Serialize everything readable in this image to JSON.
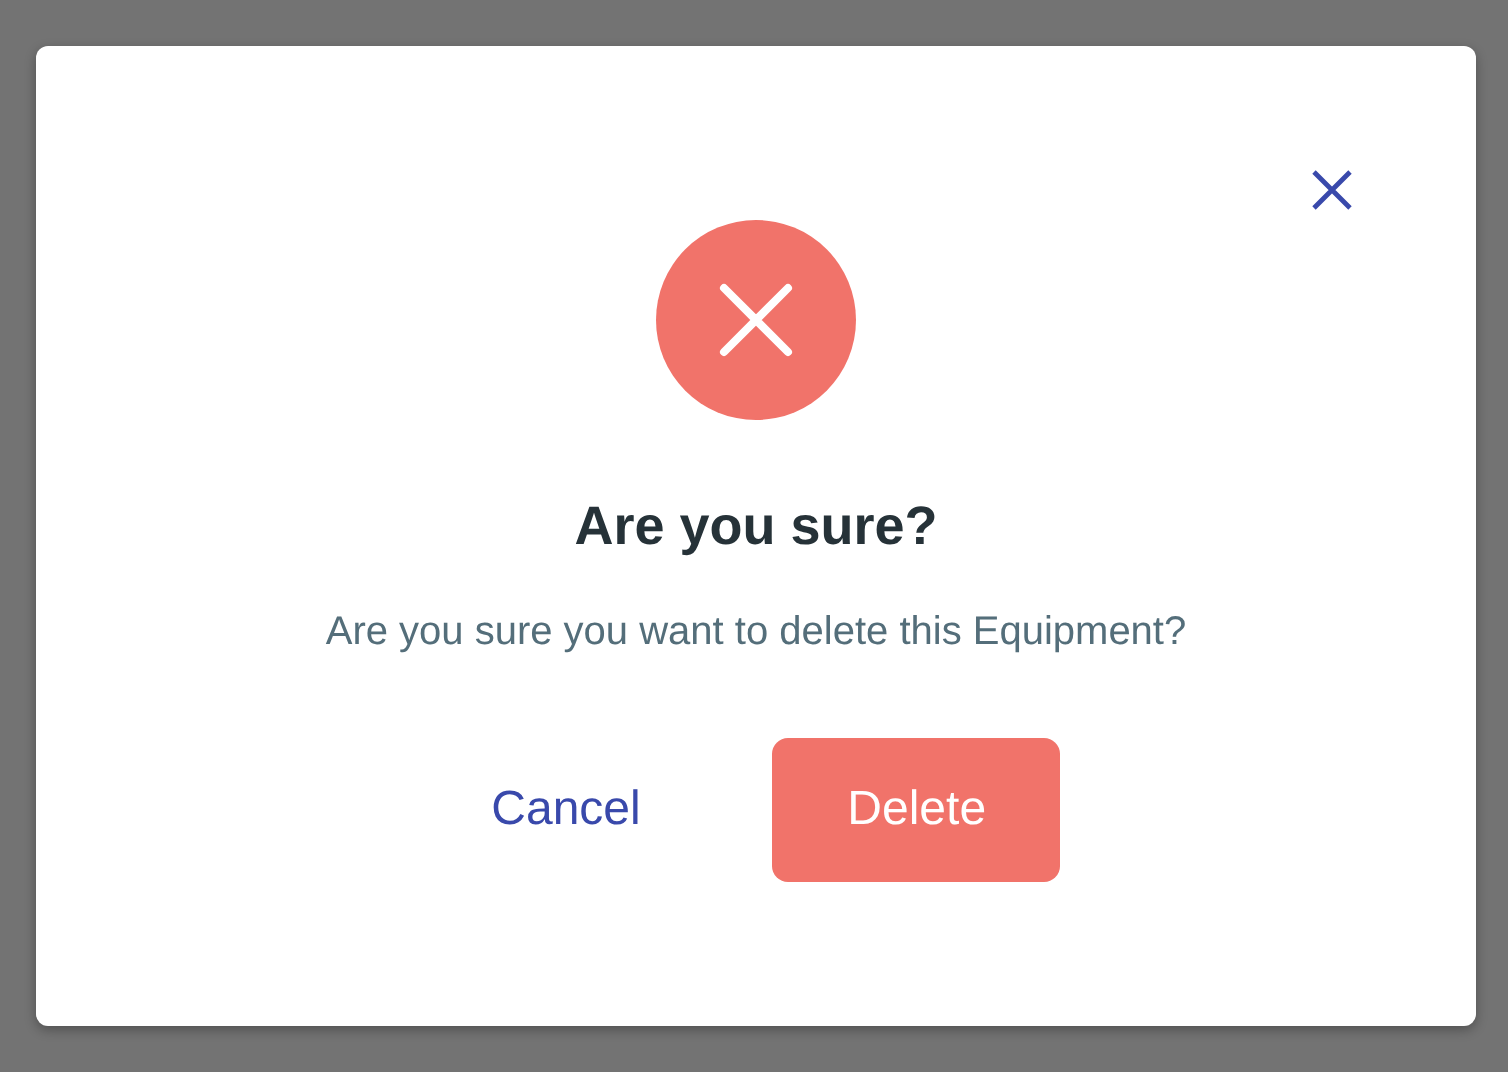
{
  "dialog": {
    "title": "Are you sure?",
    "message": "Are you sure you want to delete this Equipment?",
    "buttons": [
      {
        "label": "Cancel",
        "kind": "text"
      },
      {
        "label": "Delete",
        "kind": "filled"
      }
    ]
  }
}
